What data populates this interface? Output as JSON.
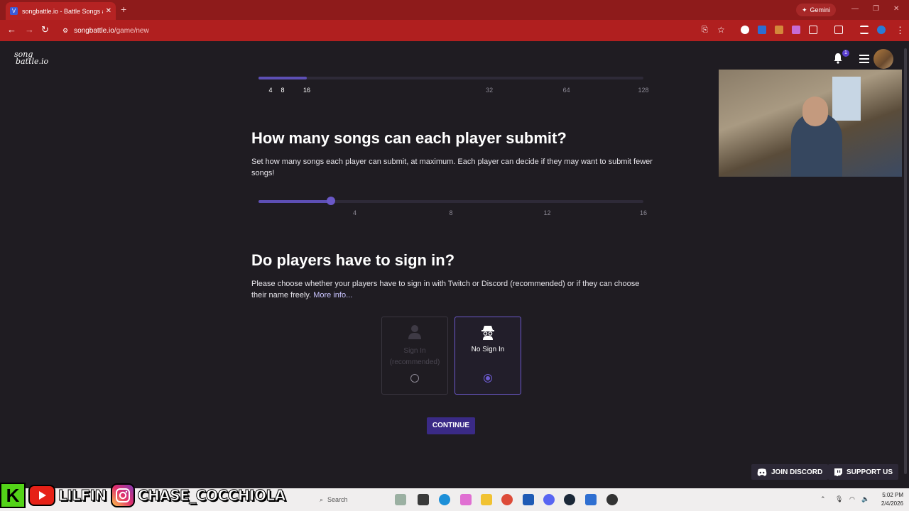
{
  "browser": {
    "tab_title": "songbattle.io - Battle Songs ag",
    "favicon": "V",
    "gemini_label": "Gemini",
    "url_host": "songbattle.io",
    "url_path": "/game/new"
  },
  "site": {
    "logo_line1": "song",
    "logo_line2": "battle.io",
    "notification_count": "1"
  },
  "top_slider": {
    "ticks": [
      "4",
      "8",
      "16",
      "32",
      "64",
      "128"
    ],
    "value": "16"
  },
  "songs_section": {
    "title": "How many songs can each player submit?",
    "description": "Set how many songs each player can submit, at maximum. Each player can decide if they may want to submit fewer songs!",
    "ticks": [
      "4",
      "8",
      "12",
      "16"
    ],
    "value": 3
  },
  "signin_section": {
    "title": "Do players have to sign in?",
    "description": "Please choose whether your players have to sign in with Twitch or Discord (recommended) or if they can choose their name freely.",
    "more_info": "More info...",
    "options": [
      {
        "label_line1": "Sign In",
        "label_line2": "(recommended)",
        "selected": false
      },
      {
        "label": "No Sign In",
        "selected": true
      }
    ]
  },
  "continue_label": "CONTINUE",
  "floating": {
    "discord": "JOIN DISCORD",
    "support": "SUPPORT US"
  },
  "overlay": {
    "name1": "LILFIN",
    "name2": "CHASE_COCCHIOLA"
  },
  "taskbar": {
    "search_placeholder": "Search",
    "time": "5:02 PM",
    "date": "2/4/2026"
  },
  "colors": {
    "accent": "#5d4fb5",
    "browser": "#b01f1f",
    "page_bg": "#1f1c22"
  }
}
